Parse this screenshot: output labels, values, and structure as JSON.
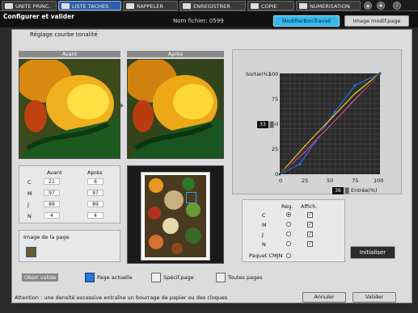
{
  "tabs": [
    {
      "label": "UNITE PRINC."
    },
    {
      "label": "LISTE TACHES"
    },
    {
      "label": "RAPPELER"
    },
    {
      "label": "ENREGISTRER"
    },
    {
      "label": "COPIE"
    },
    {
      "label": "NUMERISATION"
    }
  ],
  "header": {
    "title": "Configurer et valider",
    "filename": "Nom fichier: 0599",
    "btn_modifier": "ModifierBonTravail",
    "btn_image": "Image modif.page"
  },
  "panel": {
    "subtitle": "Réglage courbe tonalité",
    "before_label": "Avant",
    "after_label": "Après"
  },
  "table": {
    "col_before": "Avant",
    "col_after": "Après",
    "rows": [
      {
        "ch": "C",
        "before": "21",
        "after": "6"
      },
      {
        "ch": "M",
        "before": "97",
        "after": "97"
      },
      {
        "ch": "J",
        "before": "89",
        "after": "89"
      },
      {
        "ch": "N",
        "before": "4",
        "after": "4"
      }
    ]
  },
  "page_image": {
    "label": "Image de la page"
  },
  "graph": {
    "ylabel": "Sortie(%)",
    "xlabel": "Entrée(%)",
    "y_ticks": [
      "100",
      "75",
      "50",
      "25",
      "0"
    ],
    "x_ticks": [
      "0",
      "25",
      "50",
      "75",
      "100"
    ],
    "output_value": "33",
    "input_value": "36"
  },
  "chart_data": {
    "type": "line",
    "xlim": [
      0,
      100
    ],
    "ylim": [
      0,
      100
    ],
    "xlabel": "Entrée(%)",
    "ylabel": "Sortie(%)",
    "grid": true,
    "series": [
      {
        "color": "#2a6fe0",
        "x": [
          0,
          20,
          36,
          55,
          75,
          100
        ],
        "y": [
          0,
          10,
          33,
          62,
          88,
          100
        ]
      },
      {
        "color": "#e0409a",
        "x": [
          0,
          25,
          50,
          75,
          100
        ],
        "y": [
          0,
          22,
          48,
          74,
          100
        ]
      },
      {
        "color": "#e6d020",
        "x": [
          0,
          25,
          50,
          75,
          100
        ],
        "y": [
          0,
          28,
          54,
          80,
          100
        ]
      },
      {
        "color": "#202020",
        "x": [
          0,
          25,
          50,
          75,
          100
        ],
        "y": [
          0,
          24,
          50,
          76,
          100
        ]
      }
    ]
  },
  "reglage": {
    "col_reg": "Rég.",
    "col_affich": "Affich.",
    "rows": [
      {
        "ch": "C",
        "reg": true,
        "affich": true
      },
      {
        "ch": "M",
        "reg": false,
        "affich": true
      },
      {
        "ch": "J",
        "reg": false,
        "affich": true
      },
      {
        "ch": "N",
        "reg": false,
        "affich": true
      }
    ],
    "paquet_label": "Paquet CMJN"
  },
  "btn_init": "Initialiser",
  "objet": {
    "label": "Objet valide",
    "options": [
      "Page actuelle",
      "Spécif.page",
      "Toutes pages"
    ],
    "selected": "Page actuelle"
  },
  "footer": {
    "warning": "Attention : une densité excessive entraîne un bourrage de papier ou des cloques",
    "cancel": "Annuler",
    "ok": "Valider"
  },
  "colors": {
    "accent": "#36b8e8",
    "tab_active": "#2f5fa8",
    "selected": "#2b76d0"
  }
}
